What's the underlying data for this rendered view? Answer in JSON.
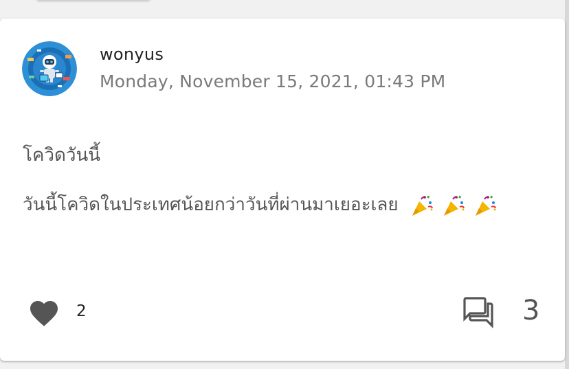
{
  "post": {
    "author": "wonyus",
    "timestamp": "Monday, November 15, 2021, 01:43 PM",
    "title": "โควิดวันนี้",
    "body": "วันนี้โควิดในประเทศน้อยกว่าวันที่ผ่านมาเยอะเลย",
    "emojis": [
      "party-popper-icon",
      "party-popper-icon",
      "party-popper-icon"
    ],
    "likes": "2",
    "comments": "3"
  },
  "icons": {
    "avatar": "robot-avatar",
    "like": "heart-icon",
    "comment": "forum-icon"
  },
  "colors": {
    "avatar_bg": "#2d8fd6",
    "icon_gray": "#555555",
    "timestamp_gray": "#7a7a7a"
  }
}
